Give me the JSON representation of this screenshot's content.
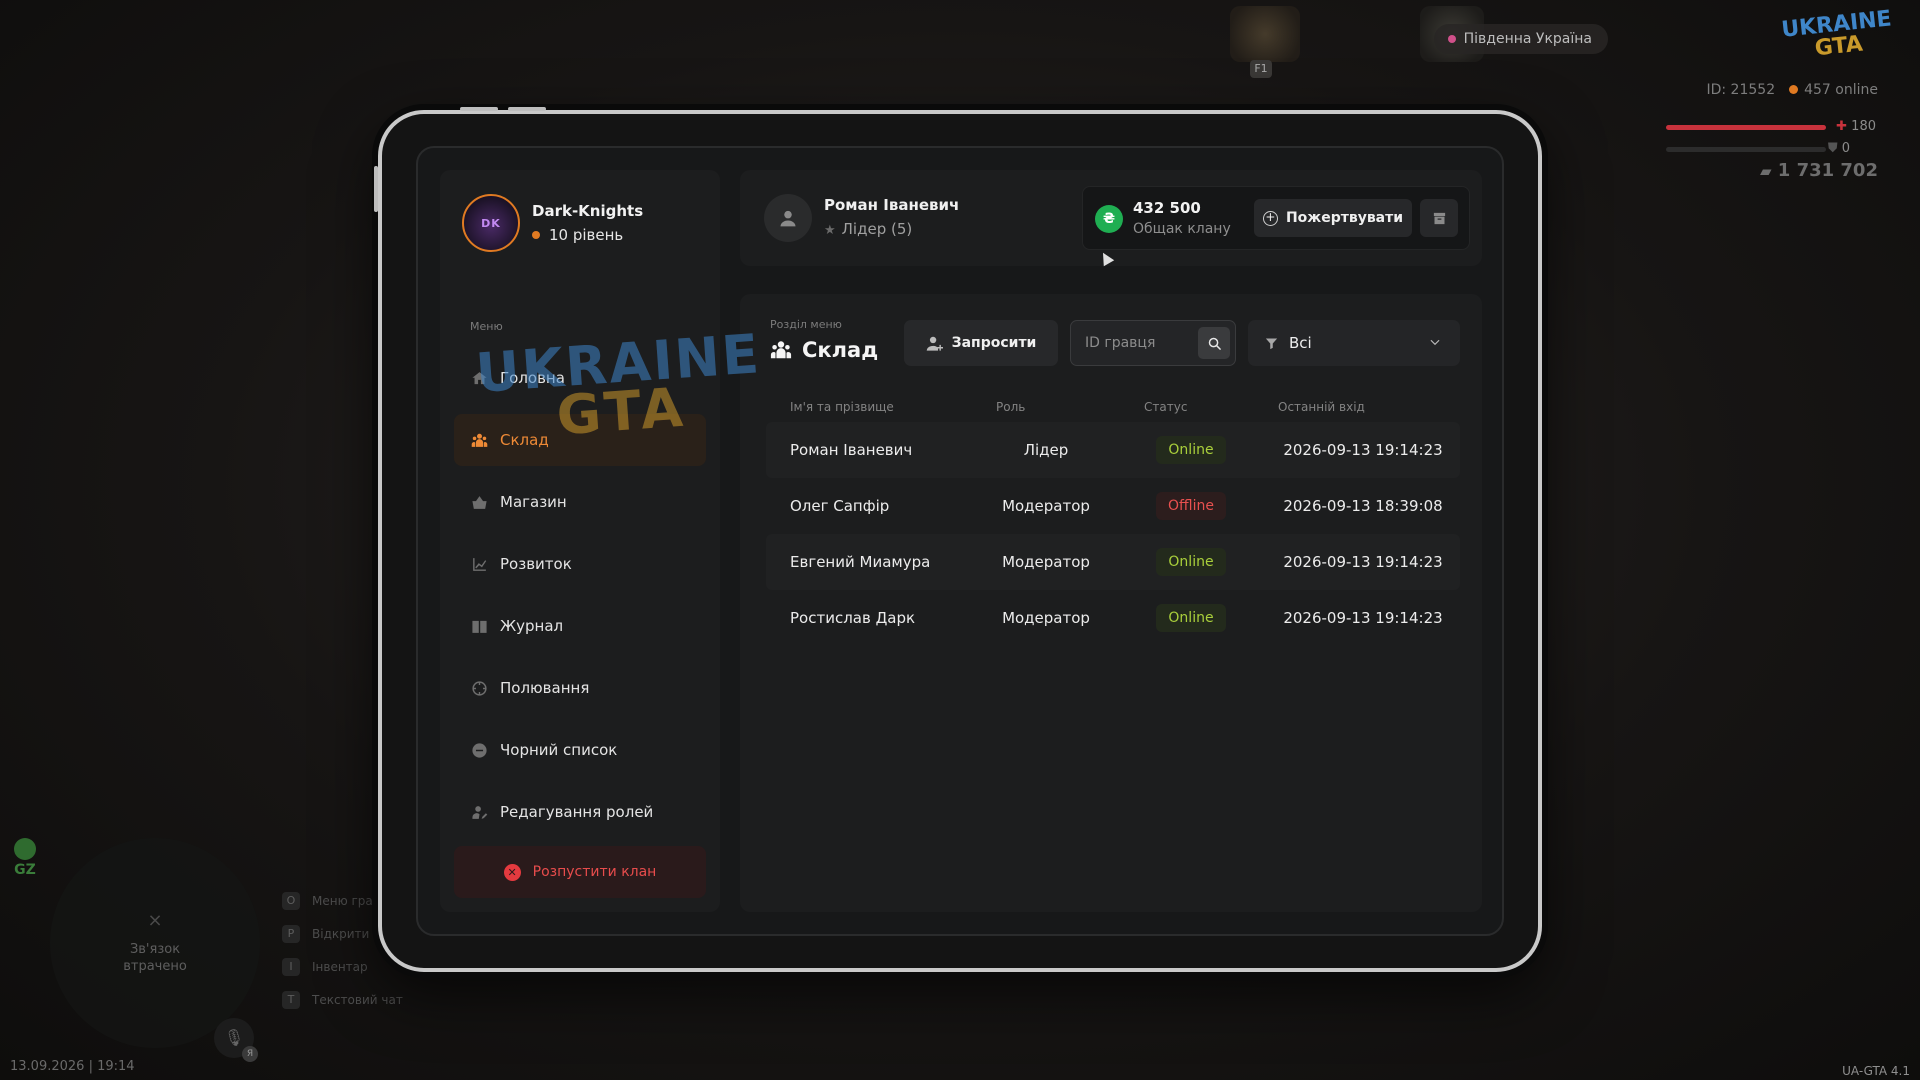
{
  "hud": {
    "region": "Південна Україна",
    "logo_line1": "UKRAINE",
    "logo_line2": "GTA",
    "player_id": "ID: 21552",
    "online": "457 online",
    "health": "180",
    "armor": "0",
    "money": "1 731 702",
    "key_f1": "F1",
    "minimap_status": "Зв'язок втрачено",
    "zone": "GZ",
    "mic_key": "Я",
    "keys": [
      {
        "key": "O",
        "label": "Меню гра"
      },
      {
        "key": "P",
        "label": "Відкрити"
      },
      {
        "key": "I",
        "label": "Інвентар"
      },
      {
        "key": "T",
        "label": "Текстовий чат"
      }
    ],
    "datetime": "13.09.2026 | 19:14",
    "version": "UA-GTA 4.1"
  },
  "clan": {
    "name": "Dark-Knights",
    "level": "10 рівень"
  },
  "sidebar": {
    "caption": "Меню",
    "items": [
      {
        "label": "Головна",
        "icon": "home-icon"
      },
      {
        "label": "Склад",
        "icon": "people-icon",
        "active": true
      },
      {
        "label": "Магазин",
        "icon": "basket-icon"
      },
      {
        "label": "Розвиток",
        "icon": "chart-icon"
      },
      {
        "label": "Журнал",
        "icon": "book-icon"
      },
      {
        "label": "Полювання",
        "icon": "crosshair-icon"
      },
      {
        "label": "Чорний список",
        "icon": "minus-circle-icon"
      },
      {
        "label": "Редагування ролей",
        "icon": "user-edit-icon"
      }
    ],
    "disband_label": "Розпустити клан"
  },
  "user": {
    "name": "Роман Іваневич",
    "role": "Лідер (5)"
  },
  "wallet": {
    "amount": "432 500",
    "label": "Общак клану",
    "currency_symbol": "₴",
    "donate_label": "Пожертвувати"
  },
  "section": {
    "caption": "Розділ меню",
    "title": "Склад",
    "invite_label": "Запросити",
    "search_placeholder": "ID гравця",
    "filter_value": "Всі"
  },
  "table": {
    "headers": {
      "name": "Ім'я та прізвище",
      "role": "Роль",
      "status": "Статус",
      "last": "Останній вхід"
    },
    "rows": [
      {
        "name": "Роман Іваневич",
        "role": "Лідер",
        "status": "Online",
        "last": "2026-09-13 19:14:23"
      },
      {
        "name": "Олег Сапфір",
        "role": "Модератор",
        "status": "Offline",
        "last": "2026-09-13 18:39:08"
      },
      {
        "name": "Евгений Миамура",
        "role": "Модератор",
        "status": "Online",
        "last": "2026-09-13 19:14:23"
      },
      {
        "name": "Ростислав Дарк",
        "role": "Модератор",
        "status": "Online",
        "last": "2026-09-13 19:14:23"
      }
    ]
  },
  "watermark": {
    "line1": "UKRAINE",
    "line2": "GTA"
  },
  "colors": {
    "accent": "#ee8a36",
    "online": "#a9cf3b",
    "offline": "#e8504f",
    "danger": "#e43a3f",
    "coin": "#1fae52"
  }
}
